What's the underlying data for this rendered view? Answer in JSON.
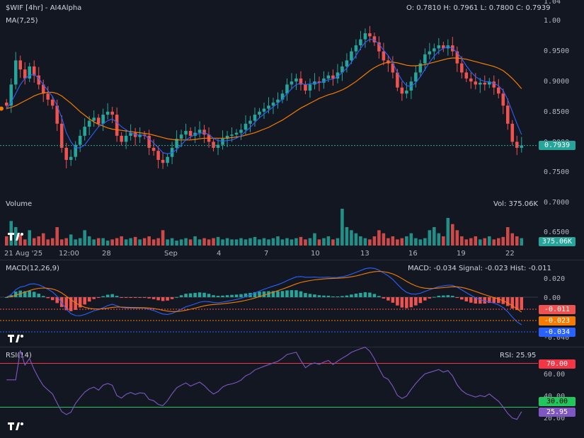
{
  "header": {
    "symbol": "$WIF [4hr] - AI4Alpha",
    "ohlc": "O: 0.7810 H: 0.7961 L: 0.7800 C: 0.7939",
    "ma": "MA(7,25)"
  },
  "volume": {
    "label": "Volume",
    "value": "Vol: 375.06K",
    "tag": "375.06K"
  },
  "macd": {
    "label": "MACD(12,26,9)",
    "values": "MACD: -0.034 Signal: -0.023 Hist: -0.011",
    "tag_hist": "-0.011",
    "tag_signal": "-0.023",
    "tag_macd": "-0.034"
  },
  "rsi": {
    "label": "RSI(14)",
    "value": "RSI: 25.95",
    "tag_upper": "70.00",
    "tag_lower": "30.00",
    "tag_value": "25.95"
  },
  "price_tag": "0.7939",
  "price_ticks": [
    "1.04",
    "1.00",
    "0.9500",
    "0.9000",
    "0.8500",
    "0.8000",
    "0.7500",
    "0.7000",
    "0.6500"
  ],
  "macd_ticks": [
    "0.020",
    "0.00",
    "-0.040"
  ],
  "rsi_ticks": [
    "60.00",
    "40.00",
    "20.00"
  ],
  "date_labels": [
    "21 Aug '25",
    "12:00",
    "28",
    "Sep",
    "4",
    "7",
    "10",
    "13",
    "16",
    "19",
    "22"
  ],
  "colors": {
    "up": "#26a69a",
    "down": "#ef5350",
    "ma7": "#2962ff",
    "ma25": "#f57c00",
    "rsi": "#7e57c2",
    "bg": "#131722"
  },
  "chart_data": {
    "type": "candlestick",
    "title": "$WIF [4hr] - AI4Alpha",
    "ylim": [
      0.7,
      1.04
    ],
    "last": {
      "open": 0.781,
      "high": 0.7961,
      "low": 0.78,
      "close": 0.7939
    },
    "closes": [
      0.86,
      0.895,
      0.935,
      0.92,
      0.905,
      0.925,
      0.91,
      0.895,
      0.88,
      0.87,
      0.86,
      0.83,
      0.79,
      0.77,
      0.775,
      0.795,
      0.81,
      0.825,
      0.835,
      0.84,
      0.83,
      0.845,
      0.85,
      0.845,
      0.81,
      0.8,
      0.81,
      0.815,
      0.808,
      0.812,
      0.81,
      0.79,
      0.785,
      0.77,
      0.765,
      0.775,
      0.79,
      0.805,
      0.812,
      0.818,
      0.81,
      0.815,
      0.82,
      0.812,
      0.8,
      0.79,
      0.795,
      0.805,
      0.81,
      0.812,
      0.815,
      0.82,
      0.83,
      0.835,
      0.845,
      0.85,
      0.855,
      0.86,
      0.865,
      0.87,
      0.88,
      0.895,
      0.9,
      0.905,
      0.895,
      0.885,
      0.895,
      0.9,
      0.898,
      0.905,
      0.91,
      0.905,
      0.915,
      0.925,
      0.935,
      0.95,
      0.96,
      0.97,
      0.98,
      0.975,
      0.965,
      0.95,
      0.935,
      0.93,
      0.915,
      0.89,
      0.88,
      0.885,
      0.9,
      0.915,
      0.93,
      0.945,
      0.95,
      0.955,
      0.96,
      0.955,
      0.96,
      0.95,
      0.93,
      0.915,
      0.905,
      0.9,
      0.895,
      0.898,
      0.895,
      0.9,
      0.89,
      0.88,
      0.86,
      0.83,
      0.8,
      0.79,
      0.794
    ],
    "volumes": [
      15,
      40,
      30,
      18,
      10,
      25,
      12,
      15,
      20,
      10,
      12,
      30,
      10,
      12,
      18,
      10,
      12,
      25,
      15,
      10,
      12,
      12,
      8,
      10,
      12,
      15,
      10,
      12,
      14,
      10,
      12,
      15,
      10,
      12,
      25,
      10,
      12,
      8,
      10,
      12,
      10,
      15,
      10,
      12,
      10,
      12,
      14,
      10,
      12,
      10,
      10,
      12,
      10,
      12,
      14,
      10,
      12,
      10,
      12,
      15,
      10,
      12,
      10,
      12,
      14,
      10,
      12,
      20,
      10,
      12,
      15,
      10,
      12,
      60,
      30,
      25,
      20,
      15,
      12,
      10,
      15,
      25,
      20,
      12,
      15,
      10,
      12,
      15,
      20,
      12,
      10,
      12,
      25,
      30,
      20,
      15,
      45,
      35,
      25,
      15,
      10,
      12,
      15,
      10,
      12,
      15,
      10,
      12,
      14,
      30,
      20,
      15,
      12
    ],
    "ma7": [
      0.855,
      0.865,
      0.88,
      0.895,
      0.905,
      0.91,
      0.912,
      0.905,
      0.895,
      0.885,
      0.875,
      0.86,
      0.84,
      0.815,
      0.8,
      0.79,
      0.79,
      0.795,
      0.805,
      0.815,
      0.825,
      0.83,
      0.835,
      0.838,
      0.832,
      0.825,
      0.82,
      0.815,
      0.812,
      0.811,
      0.811,
      0.805,
      0.798,
      0.79,
      0.782,
      0.78,
      0.782,
      0.787,
      0.795,
      0.803,
      0.808,
      0.812,
      0.814,
      0.815,
      0.812,
      0.806,
      0.802,
      0.801,
      0.802,
      0.803,
      0.806,
      0.81,
      0.817,
      0.824,
      0.832,
      0.84,
      0.846,
      0.852,
      0.858,
      0.864,
      0.871,
      0.88,
      0.888,
      0.895,
      0.897,
      0.895,
      0.896,
      0.897,
      0.898,
      0.9,
      0.903,
      0.904,
      0.908,
      0.915,
      0.922,
      0.932,
      0.943,
      0.955,
      0.965,
      0.97,
      0.969,
      0.962,
      0.952,
      0.943,
      0.931,
      0.915,
      0.902,
      0.893,
      0.892,
      0.898,
      0.908,
      0.92,
      0.932,
      0.942,
      0.95,
      0.955,
      0.958,
      0.955,
      0.948,
      0.938,
      0.926,
      0.916,
      0.908,
      0.903,
      0.9,
      0.899,
      0.897,
      0.893,
      0.885,
      0.87,
      0.85,
      0.83,
      0.812
    ],
    "ma25": [
      0.855,
      0.857,
      0.86,
      0.864,
      0.868,
      0.872,
      0.876,
      0.879,
      0.881,
      0.882,
      0.882,
      0.88,
      0.876,
      0.87,
      0.864,
      0.857,
      0.85,
      0.844,
      0.838,
      0.833,
      0.829,
      0.826,
      0.823,
      0.821,
      0.82,
      0.819,
      0.818,
      0.817,
      0.816,
      0.815,
      0.814,
      0.813,
      0.811,
      0.809,
      0.807,
      0.805,
      0.804,
      0.803,
      0.803,
      0.803,
      0.803,
      0.804,
      0.805,
      0.806,
      0.806,
      0.806,
      0.806,
      0.806,
      0.806,
      0.807,
      0.808,
      0.809,
      0.811,
      0.813,
      0.815,
      0.818,
      0.821,
      0.824,
      0.828,
      0.832,
      0.836,
      0.841,
      0.846,
      0.851,
      0.856,
      0.86,
      0.864,
      0.868,
      0.872,
      0.875,
      0.878,
      0.88,
      0.883,
      0.886,
      0.89,
      0.895,
      0.9,
      0.906,
      0.912,
      0.918,
      0.923,
      0.927,
      0.93,
      0.932,
      0.932,
      0.931,
      0.929,
      0.927,
      0.926,
      0.926,
      0.927,
      0.928,
      0.93,
      0.932,
      0.934,
      0.936,
      0.938,
      0.939,
      0.939,
      0.938,
      0.937,
      0.935,
      0.933,
      0.931,
      0.929,
      0.927,
      0.925,
      0.922,
      0.918,
      0.912,
      0.905,
      0.897,
      0.888
    ]
  }
}
